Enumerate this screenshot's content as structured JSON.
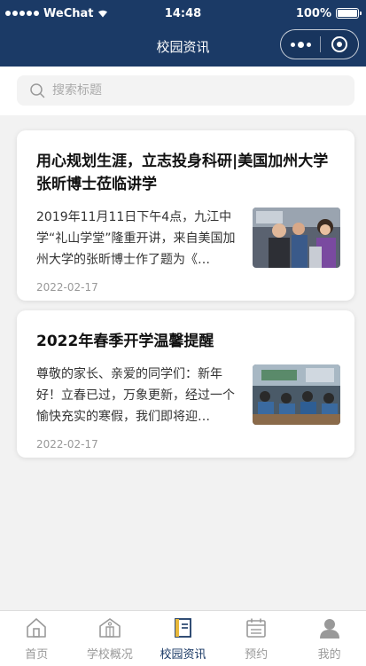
{
  "status_bar": {
    "carrier": "WeChat",
    "time": "14:48",
    "battery": "100%"
  },
  "header": {
    "title": "校园资讯"
  },
  "search": {
    "placeholder": "搜索标题"
  },
  "articles": [
    {
      "title": "用心规划生涯，立志投身科研|美国加州大学张昕博士莅临讲学",
      "excerpt": "2019年11月11日下午4点，九江中学“礼山学堂”隆重开讲，来自美国加州大学的张昕博士作了题为《…",
      "date": "2022-02-17"
    },
    {
      "title": "2022年春季开学温馨提醒",
      "excerpt": "尊敬的家长、亲爱的同学们：新年好！立春已过，万象更新，经过一个愉快充实的寒假，我们即将迎…",
      "date": "2022-02-17"
    }
  ],
  "tabbar": {
    "items": [
      {
        "label": "首页",
        "icon": "home-icon"
      },
      {
        "label": "学校概况",
        "icon": "school-building-icon"
      },
      {
        "label": "校园资讯",
        "icon": "news-book-icon"
      },
      {
        "label": "预约",
        "icon": "calendar-icon"
      },
      {
        "label": "我的",
        "icon": "user-icon"
      }
    ],
    "active_index": 2
  },
  "colors": {
    "primary": "#1b3a66",
    "inactive": "#999999"
  }
}
